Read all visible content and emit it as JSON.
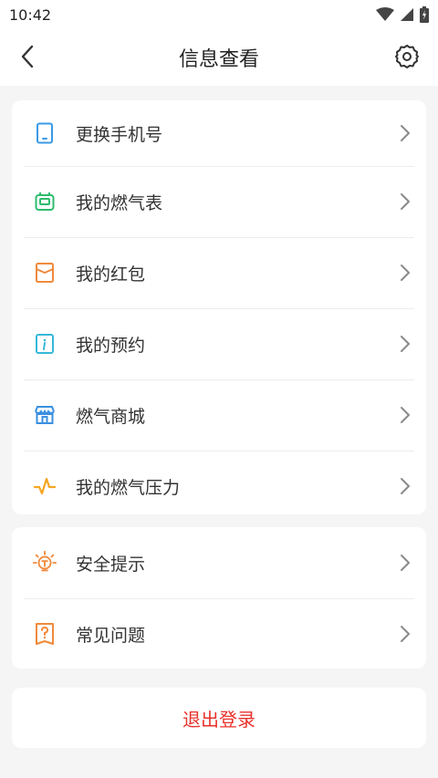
{
  "status_bar": {
    "time": "10:42"
  },
  "header": {
    "title": "信息查看"
  },
  "menu_group_1": [
    {
      "label": "更换手机号",
      "icon": "phone-icon",
      "color": "#3a9ae8"
    },
    {
      "label": "我的燃气表",
      "icon": "gas-meter-icon",
      "color": "#2dbb6e"
    },
    {
      "label": "我的红包",
      "icon": "red-packet-icon",
      "color": "#f08a3c"
    },
    {
      "label": "我的预约",
      "icon": "info-icon",
      "color": "#36b8d8"
    },
    {
      "label": "燃气商城",
      "icon": "store-icon",
      "color": "#3a8fe0"
    },
    {
      "label": "我的燃气压力",
      "icon": "pressure-icon",
      "color": "#f5a623"
    }
  ],
  "menu_group_2": [
    {
      "label": "安全提示",
      "icon": "bulb-icon",
      "color": "#f08a3c"
    },
    {
      "label": "常见问题",
      "icon": "question-book-icon",
      "color": "#f08a3c"
    }
  ],
  "logout": {
    "label": "退出登录",
    "color": "#e8322c"
  }
}
